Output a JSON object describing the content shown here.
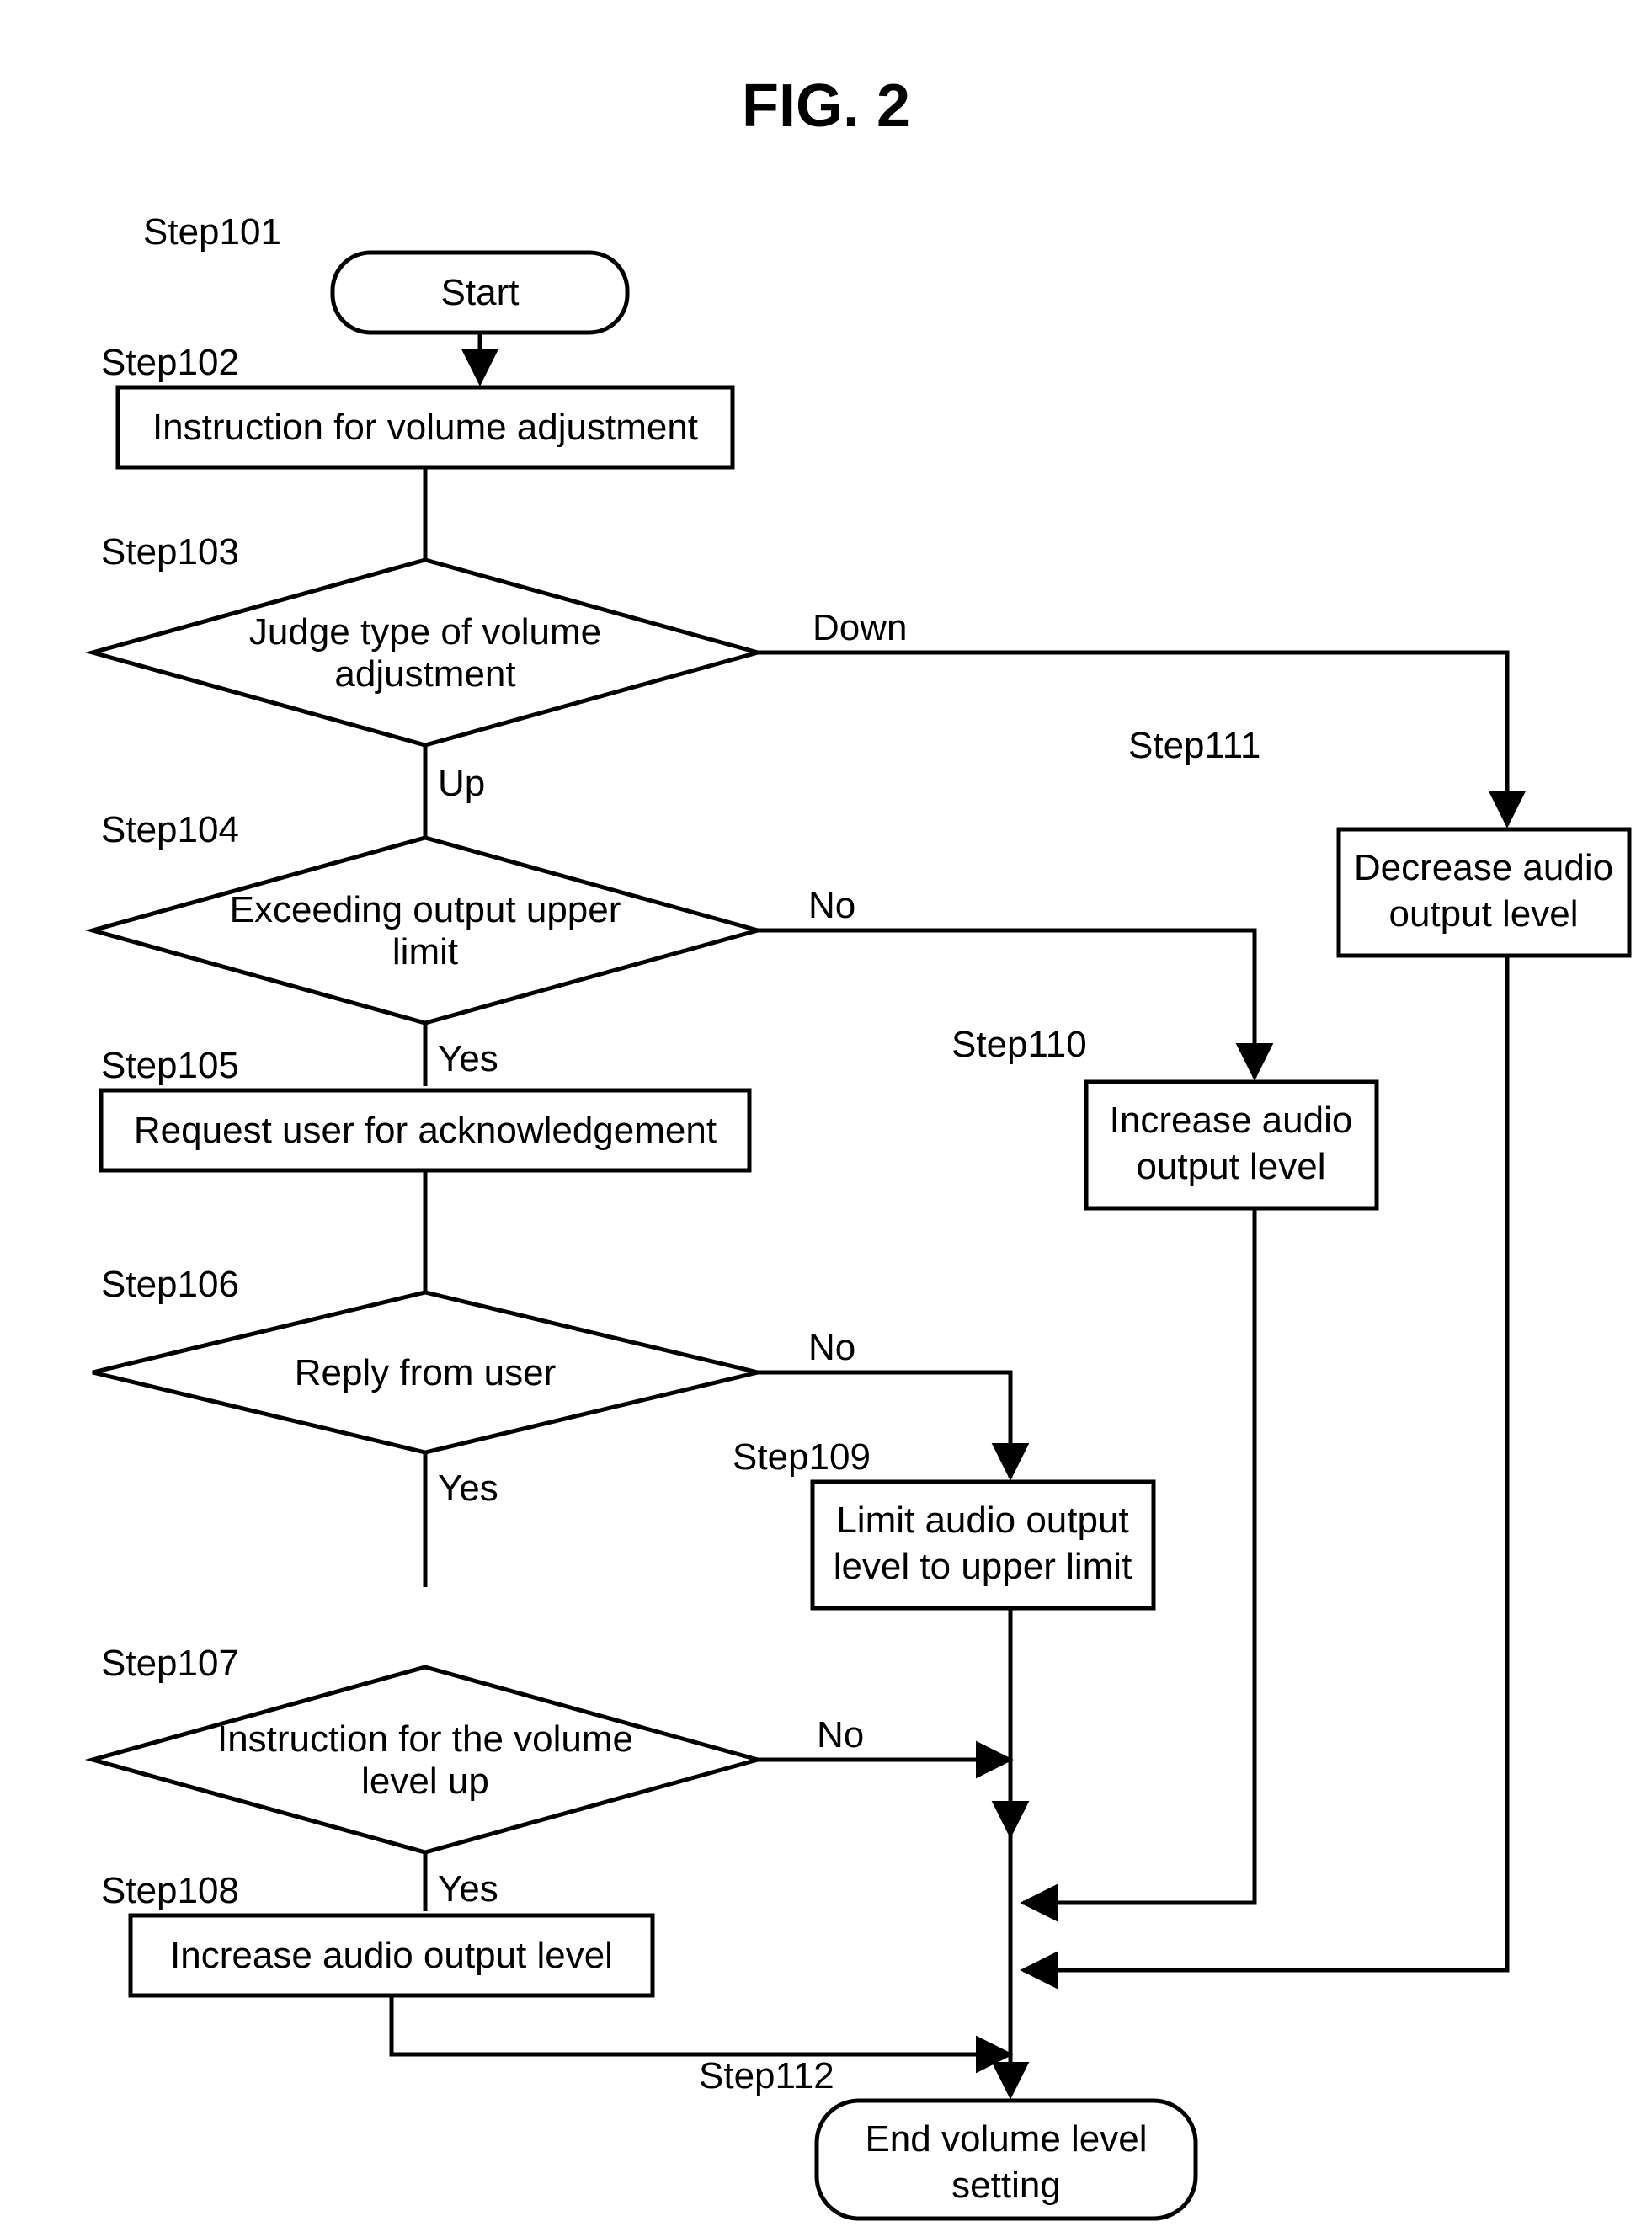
{
  "chart_data": {
    "type": "flowchart",
    "title": "FIG. 2",
    "nodes": [
      {
        "id": "n101",
        "kind": "terminator",
        "step": "Step101",
        "text": "Start"
      },
      {
        "id": "n102",
        "kind": "process",
        "step": "Step102",
        "text": "Instruction for volume adjustment"
      },
      {
        "id": "n103",
        "kind": "decision",
        "step": "Step103",
        "text1": "Judge type of volume",
        "text2": "adjustment",
        "branches": {
          "Down": "n111",
          "Up": "n104"
        }
      },
      {
        "id": "n104",
        "kind": "decision",
        "step": "Step104",
        "text1": "Exceeding output upper",
        "text2": "limit",
        "branches": {
          "No": "n110",
          "Yes": "n105"
        }
      },
      {
        "id": "n105",
        "kind": "process",
        "step": "Step105",
        "text": "Request user for acknowledgement"
      },
      {
        "id": "n106",
        "kind": "decision",
        "step": "Step106",
        "text1": "Reply from user",
        "branches": {
          "No": "n109",
          "Yes": "n107"
        }
      },
      {
        "id": "n107",
        "kind": "decision",
        "step": "Step107",
        "text1": "Instruction for the volume",
        "text2": "level up",
        "branches": {
          "No": "n112",
          "Yes": "n108"
        }
      },
      {
        "id": "n108",
        "kind": "process",
        "step": "Step108",
        "text": "Increase audio output level"
      },
      {
        "id": "n109",
        "kind": "process",
        "step": "Step109",
        "text1": "Limit audio output",
        "text2": "level to upper limit"
      },
      {
        "id": "n110",
        "kind": "process",
        "step": "Step110",
        "text1": "Increase audio",
        "text2": "output level"
      },
      {
        "id": "n111",
        "kind": "process",
        "step": "Step111",
        "text1": "Decrease audio",
        "text2": "output level"
      },
      {
        "id": "n112",
        "kind": "terminator",
        "step": "Step112",
        "text1": "End volume level",
        "text2": "setting"
      }
    ],
    "edges": [
      {
        "from": "n101",
        "to": "n102"
      },
      {
        "from": "n102",
        "to": "n103"
      },
      {
        "from": "n103",
        "to": "n104",
        "label": "Up"
      },
      {
        "from": "n103",
        "to": "n111",
        "label": "Down"
      },
      {
        "from": "n104",
        "to": "n105",
        "label": "Yes"
      },
      {
        "from": "n104",
        "to": "n110",
        "label": "No"
      },
      {
        "from": "n105",
        "to": "n106"
      },
      {
        "from": "n106",
        "to": "n107",
        "label": "Yes"
      },
      {
        "from": "n106",
        "to": "n109",
        "label": "No"
      },
      {
        "from": "n107",
        "to": "n108",
        "label": "Yes"
      },
      {
        "from": "n107",
        "to": "n112",
        "label": "No"
      },
      {
        "from": "n108",
        "to": "n112"
      },
      {
        "from": "n109",
        "to": "n112"
      },
      {
        "from": "n110",
        "to": "n112"
      },
      {
        "from": "n111",
        "to": "n112"
      }
    ]
  },
  "labels": {
    "up": "Up",
    "down": "Down",
    "yes": "Yes",
    "no": "No"
  }
}
